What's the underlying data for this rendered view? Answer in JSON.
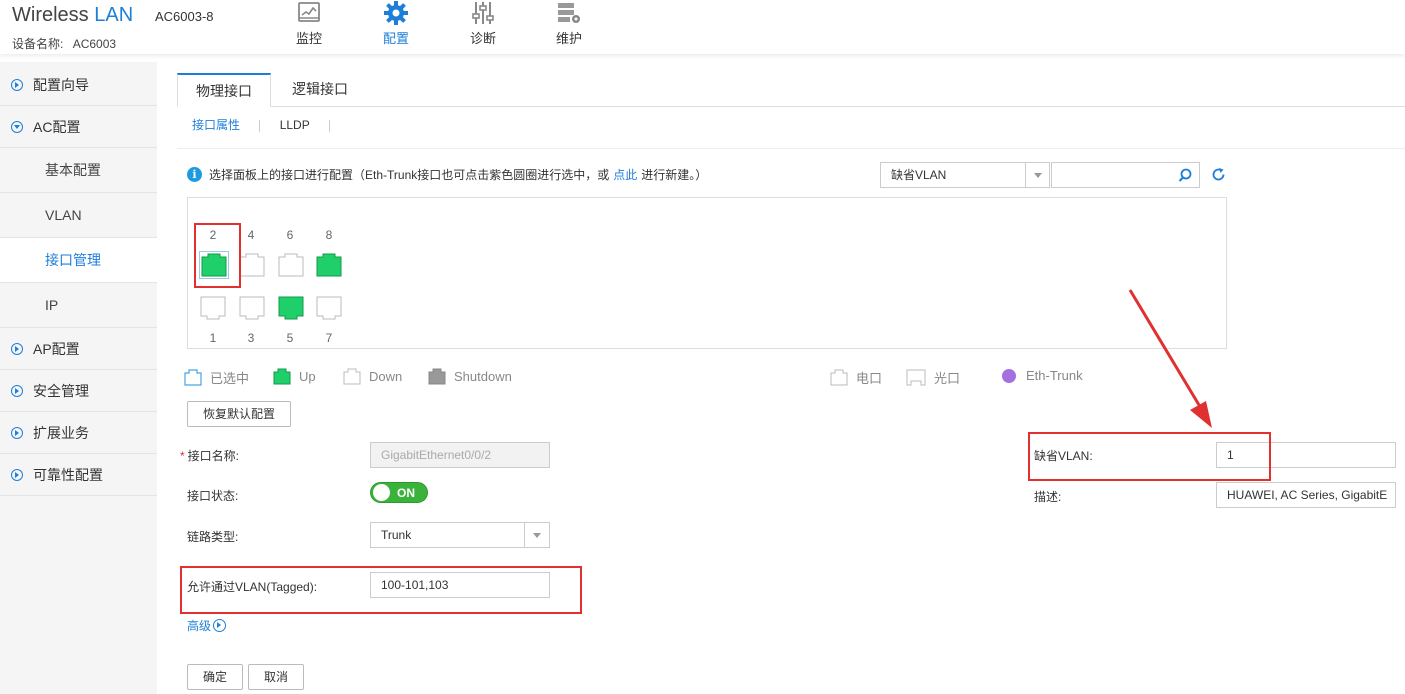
{
  "header": {
    "brand_text": "Wireless",
    "brand_lan": "LAN",
    "model": "AC6003-8",
    "device_name_label": "设备名称:",
    "device_name_value": "AC6003",
    "nav": [
      {
        "label": "监控",
        "icon": "monitor-icon"
      },
      {
        "label": "配置",
        "icon": "gear-icon"
      },
      {
        "label": "诊断",
        "icon": "sliders-icon"
      },
      {
        "label": "维护",
        "icon": "maintenance-icon"
      }
    ],
    "active_nav": "配置"
  },
  "sidebar": {
    "items": [
      {
        "label": "配置向导"
      },
      {
        "label": "AC配置",
        "expanded": true
      },
      {
        "label": "AP配置"
      },
      {
        "label": "安全管理"
      },
      {
        "label": "扩展业务"
      },
      {
        "label": "可靠性配置"
      }
    ],
    "sub_items": [
      {
        "label": "基本配置"
      },
      {
        "label": "VLAN"
      },
      {
        "label": "接口管理",
        "active": true
      },
      {
        "label": "IP"
      }
    ]
  },
  "tabs": [
    {
      "label": "物理接口",
      "active": true
    },
    {
      "label": "逻辑接口"
    }
  ],
  "subtabs": [
    {
      "label": "接口属性",
      "active": true
    },
    {
      "label": "LLDP"
    }
  ],
  "info": {
    "text_before": "选择面板上的接口进行配置（Eth-Trunk接口也可点击紫色圆圈进行选中，或",
    "link": "点此",
    "text_after": "进行新建。）"
  },
  "filter": {
    "select_value": "缺省VLAN",
    "search_value": ""
  },
  "ports": {
    "top_row": [
      {
        "num": "2",
        "state": "up",
        "selected": true
      },
      {
        "num": "4",
        "state": "down"
      },
      {
        "num": "6",
        "state": "down"
      },
      {
        "num": "8",
        "state": "up"
      }
    ],
    "bottom_row": [
      {
        "num": "1",
        "state": "down"
      },
      {
        "num": "3",
        "state": "down"
      },
      {
        "num": "5",
        "state": "up"
      },
      {
        "num": "7",
        "state": "down"
      }
    ]
  },
  "legend": {
    "selected": "已选中",
    "up": "Up",
    "down": "Down",
    "shutdown": "Shutdown",
    "electrical": "电口",
    "optical": "光口",
    "eth_trunk": "Eth-Trunk"
  },
  "buttons": {
    "restore_default": "恢复默认配置",
    "confirm": "确定",
    "cancel": "取消"
  },
  "form": {
    "if_name_label": "接口名称:",
    "if_name_value": "GigabitEthernet0/0/2",
    "if_status_label": "接口状态:",
    "if_status_value": "ON",
    "link_type_label": "链路类型:",
    "link_type_value": "Trunk",
    "tagged_label": "允许通过VLAN(Tagged):",
    "tagged_value": "100-101,103",
    "pvid_label": "缺省VLAN:",
    "pvid_value": "1",
    "desc_label": "描述:",
    "desc_value": "HUAWEI, AC Series, GigabitE",
    "advanced": "高级"
  },
  "colors": {
    "accent": "#1e7fd8",
    "port_up": "#1fd06a",
    "highlight_red": "#e03030",
    "toggle_on": "#3bb33b"
  }
}
